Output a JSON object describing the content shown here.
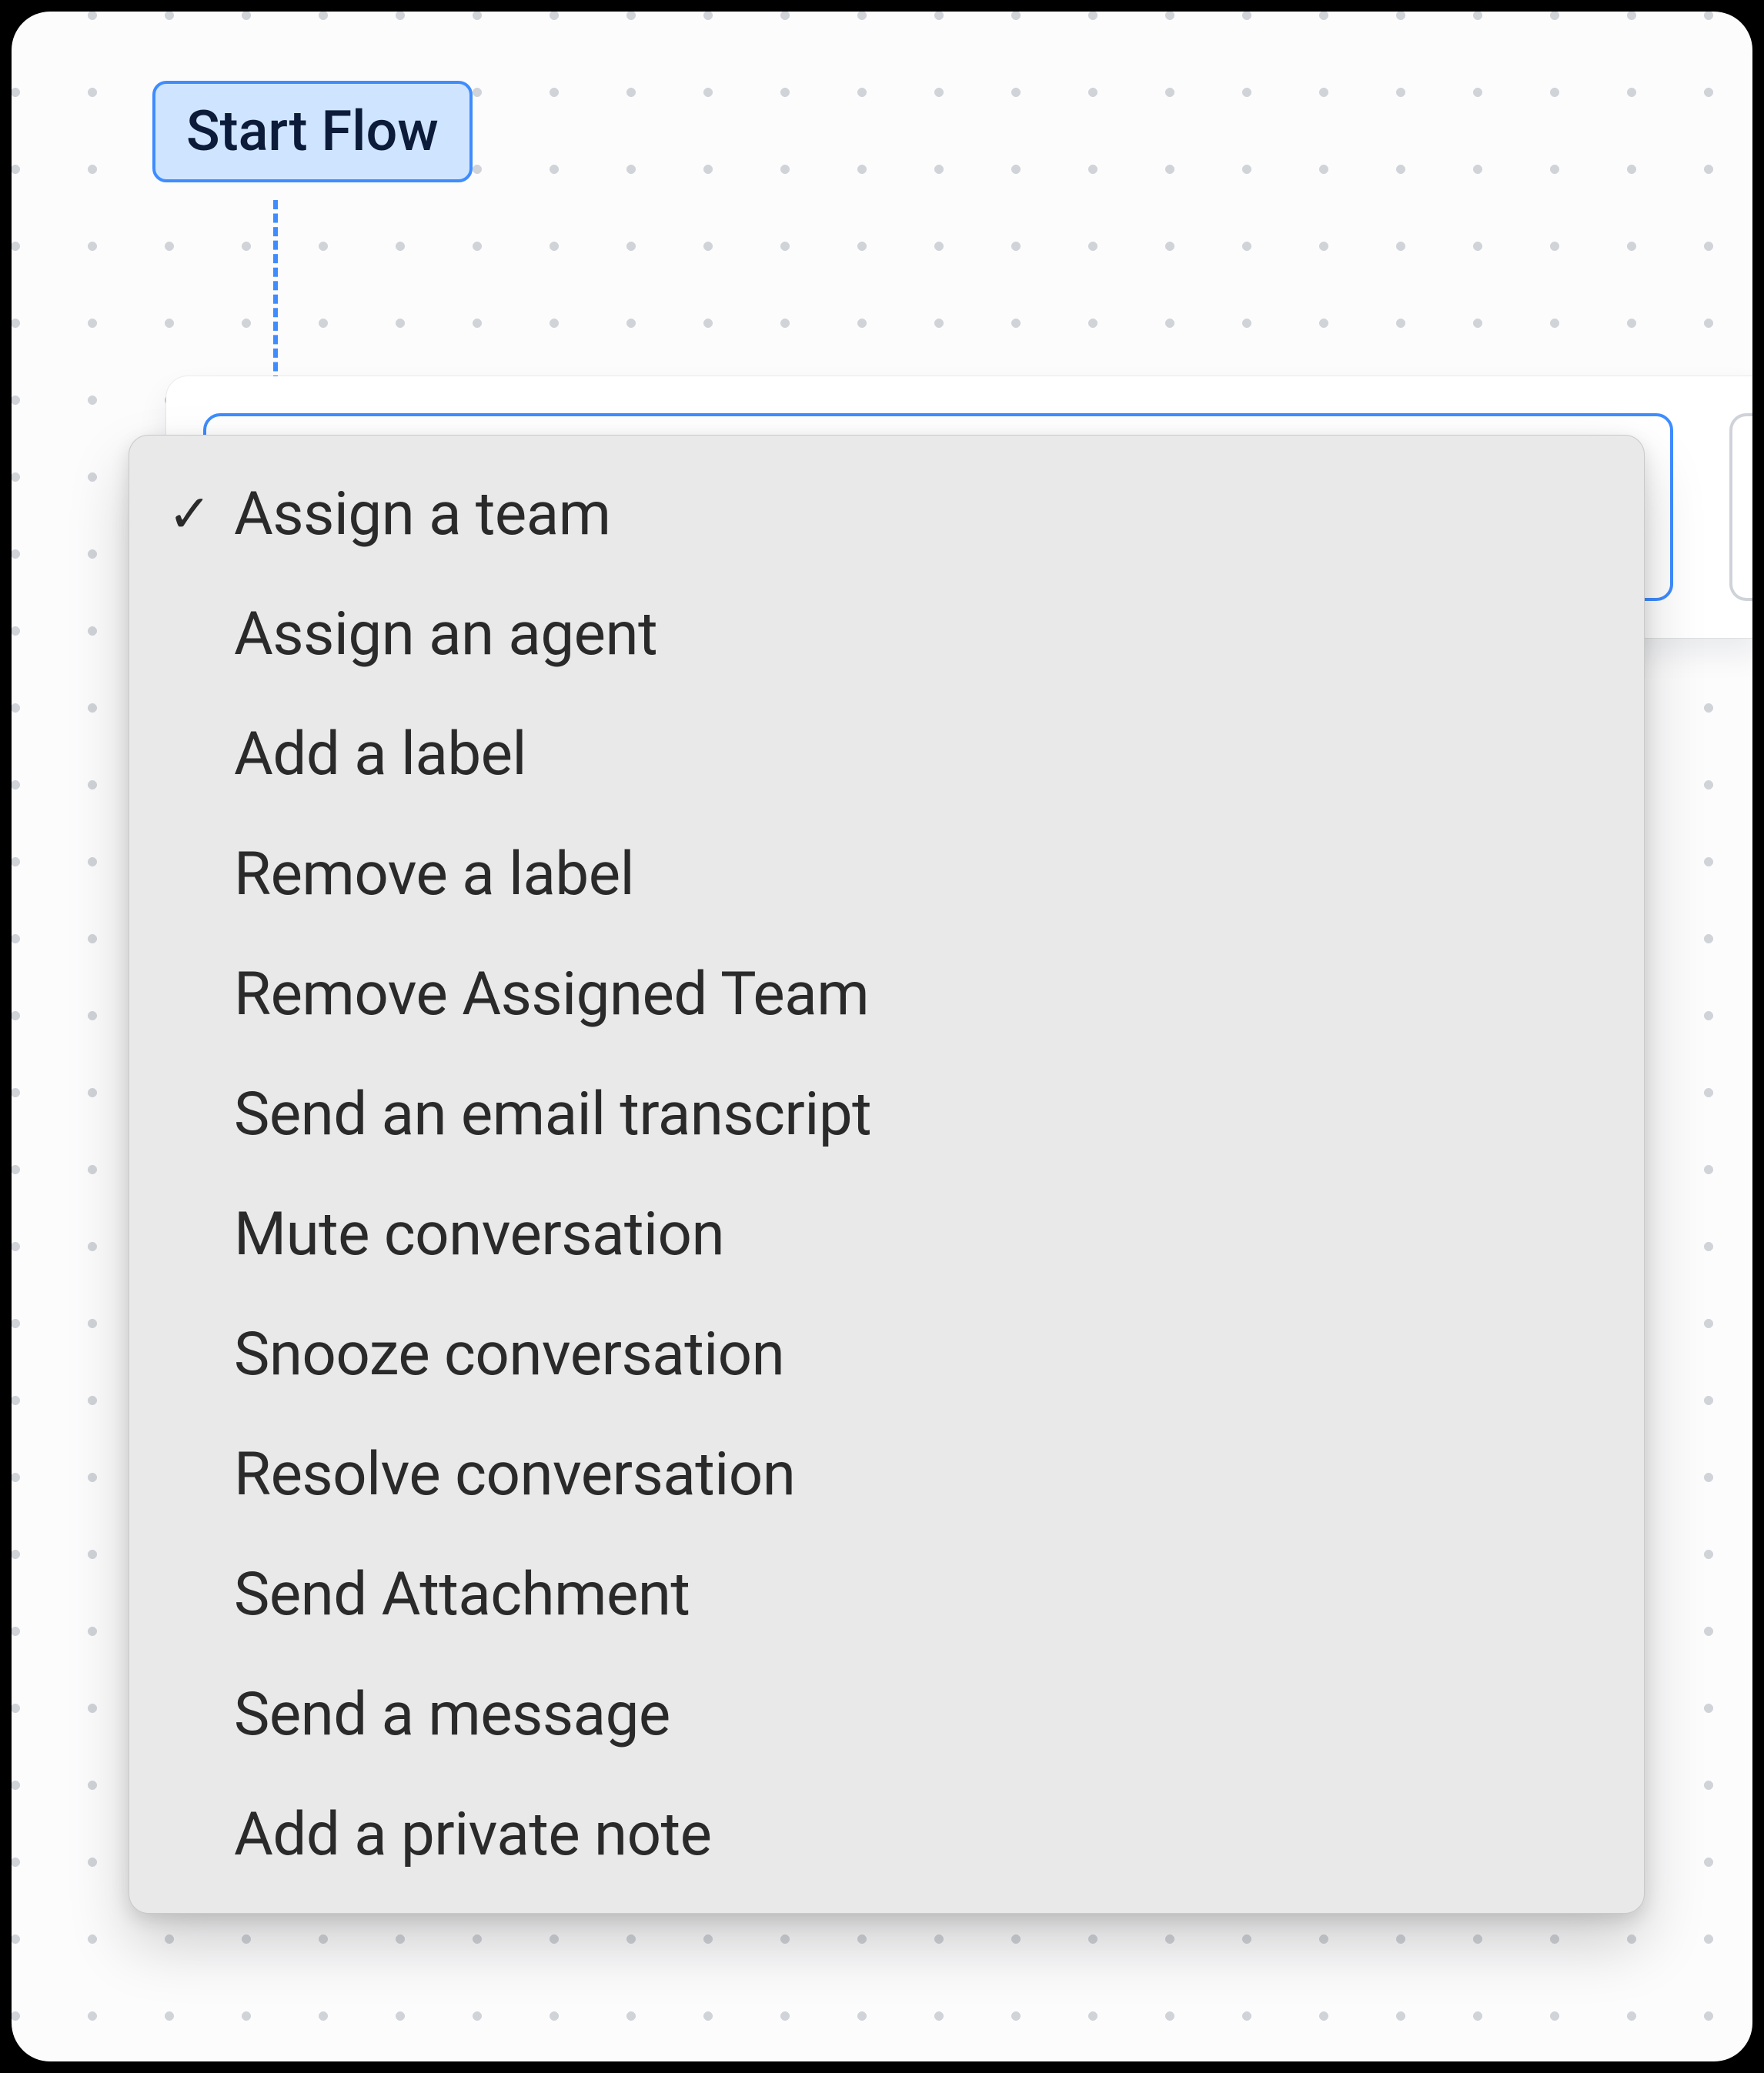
{
  "flow": {
    "start_label": "Start Flow"
  },
  "dropdown": {
    "selected_index": 0,
    "items": [
      {
        "label": "Assign a team"
      },
      {
        "label": "Assign an agent"
      },
      {
        "label": "Add a label"
      },
      {
        "label": "Remove a label"
      },
      {
        "label": "Remove Assigned Team"
      },
      {
        "label": "Send an email transcript"
      },
      {
        "label": "Mute conversation"
      },
      {
        "label": "Snooze conversation"
      },
      {
        "label": "Resolve conversation"
      },
      {
        "label": "Send Attachment"
      },
      {
        "label": "Send a message"
      },
      {
        "label": "Add a private note"
      }
    ]
  },
  "icons": {
    "check": "✓"
  }
}
